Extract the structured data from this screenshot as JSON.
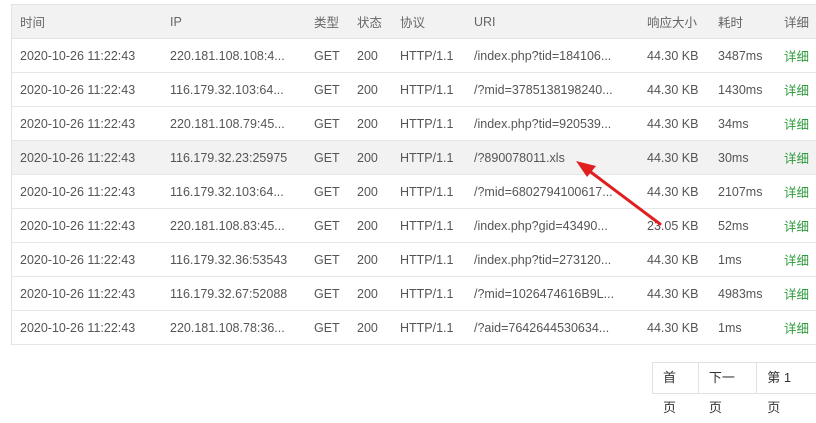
{
  "columns": {
    "time": "时间",
    "ip": "IP",
    "type": "类型",
    "status": "状态",
    "protocol": "协议",
    "uri": "URI",
    "size": "响应大小",
    "duration": "耗时",
    "detail": "详细"
  },
  "rows": [
    {
      "time": "2020-10-26 11:22:43",
      "ip": "220.181.108.108:4...",
      "type": "GET",
      "status": "200",
      "protocol": "HTTP/1.1",
      "uri": "/index.php?tid=184106...",
      "size": "44.30 KB",
      "duration": "3487ms",
      "detail": "详细"
    },
    {
      "time": "2020-10-26 11:22:43",
      "ip": "116.179.32.103:64...",
      "type": "GET",
      "status": "200",
      "protocol": "HTTP/1.1",
      "uri": "/?mid=3785138198240...",
      "size": "44.30 KB",
      "duration": "1430ms",
      "detail": "详细"
    },
    {
      "time": "2020-10-26 11:22:43",
      "ip": "220.181.108.79:45...",
      "type": "GET",
      "status": "200",
      "protocol": "HTTP/1.1",
      "uri": "/index.php?tid=920539...",
      "size": "44.30 KB",
      "duration": "34ms",
      "detail": "详细"
    },
    {
      "time": "2020-10-26 11:22:43",
      "ip": "116.179.32.23:25975",
      "type": "GET",
      "status": "200",
      "protocol": "HTTP/1.1",
      "uri": "/?890078011.xls",
      "size": "44.30 KB",
      "duration": "30ms",
      "detail": "详细"
    },
    {
      "time": "2020-10-26 11:22:43",
      "ip": "116.179.32.103:64...",
      "type": "GET",
      "status": "200",
      "protocol": "HTTP/1.1",
      "uri": "/?mid=6802794100617...",
      "size": "44.30 KB",
      "duration": "2107ms",
      "detail": "详细"
    },
    {
      "time": "2020-10-26 11:22:43",
      "ip": "220.181.108.83:45...",
      "type": "GET",
      "status": "200",
      "protocol": "HTTP/1.1",
      "uri": "/index.php?gid=43490...",
      "size": "23.05 KB",
      "duration": "52ms",
      "detail": "详细"
    },
    {
      "time": "2020-10-26 11:22:43",
      "ip": "116.179.32.36:53543",
      "type": "GET",
      "status": "200",
      "protocol": "HTTP/1.1",
      "uri": "/index.php?tid=273120...",
      "size": "44.30 KB",
      "duration": "1ms",
      "detail": "详细"
    },
    {
      "time": "2020-10-26 11:22:43",
      "ip": "116.179.32.67:52088",
      "type": "GET",
      "status": "200",
      "protocol": "HTTP/1.1",
      "uri": "/?mid=1026474616B9L...",
      "size": "44.30 KB",
      "duration": "4983ms",
      "detail": "详细"
    },
    {
      "time": "2020-10-26 11:22:43",
      "ip": "220.181.108.78:36...",
      "type": "GET",
      "status": "200",
      "protocol": "HTTP/1.1",
      "uri": "/?aid=7642644530634...",
      "size": "44.30 KB",
      "duration": "1ms",
      "detail": "详细"
    }
  ],
  "pagination": {
    "first": "首页",
    "next": "下一页",
    "current": "第 1 页"
  },
  "colors": {
    "detail_link": "#2e9b3c",
    "annotation_arrow": "#e02020",
    "header_bg": "#f2f2f2"
  }
}
